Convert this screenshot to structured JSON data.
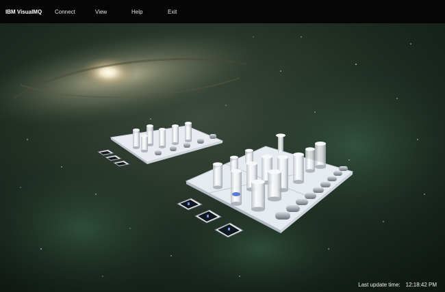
{
  "app": {
    "title": "IBM VisualMQ"
  },
  "menu": {
    "items": [
      {
        "label": "Connect"
      },
      {
        "label": "View"
      },
      {
        "label": "Help"
      },
      {
        "label": "Exit"
      }
    ]
  },
  "status": {
    "label": "Last update time:",
    "time": "12:18:42 PM"
  },
  "colors": {
    "menubar_bg": "#050505",
    "space_bg": "#0c1410",
    "platform": "#e9eef4"
  },
  "icons": [
    "queue-cylinder-icon",
    "channel-pipe-icon",
    "connection-tile-icon"
  ]
}
